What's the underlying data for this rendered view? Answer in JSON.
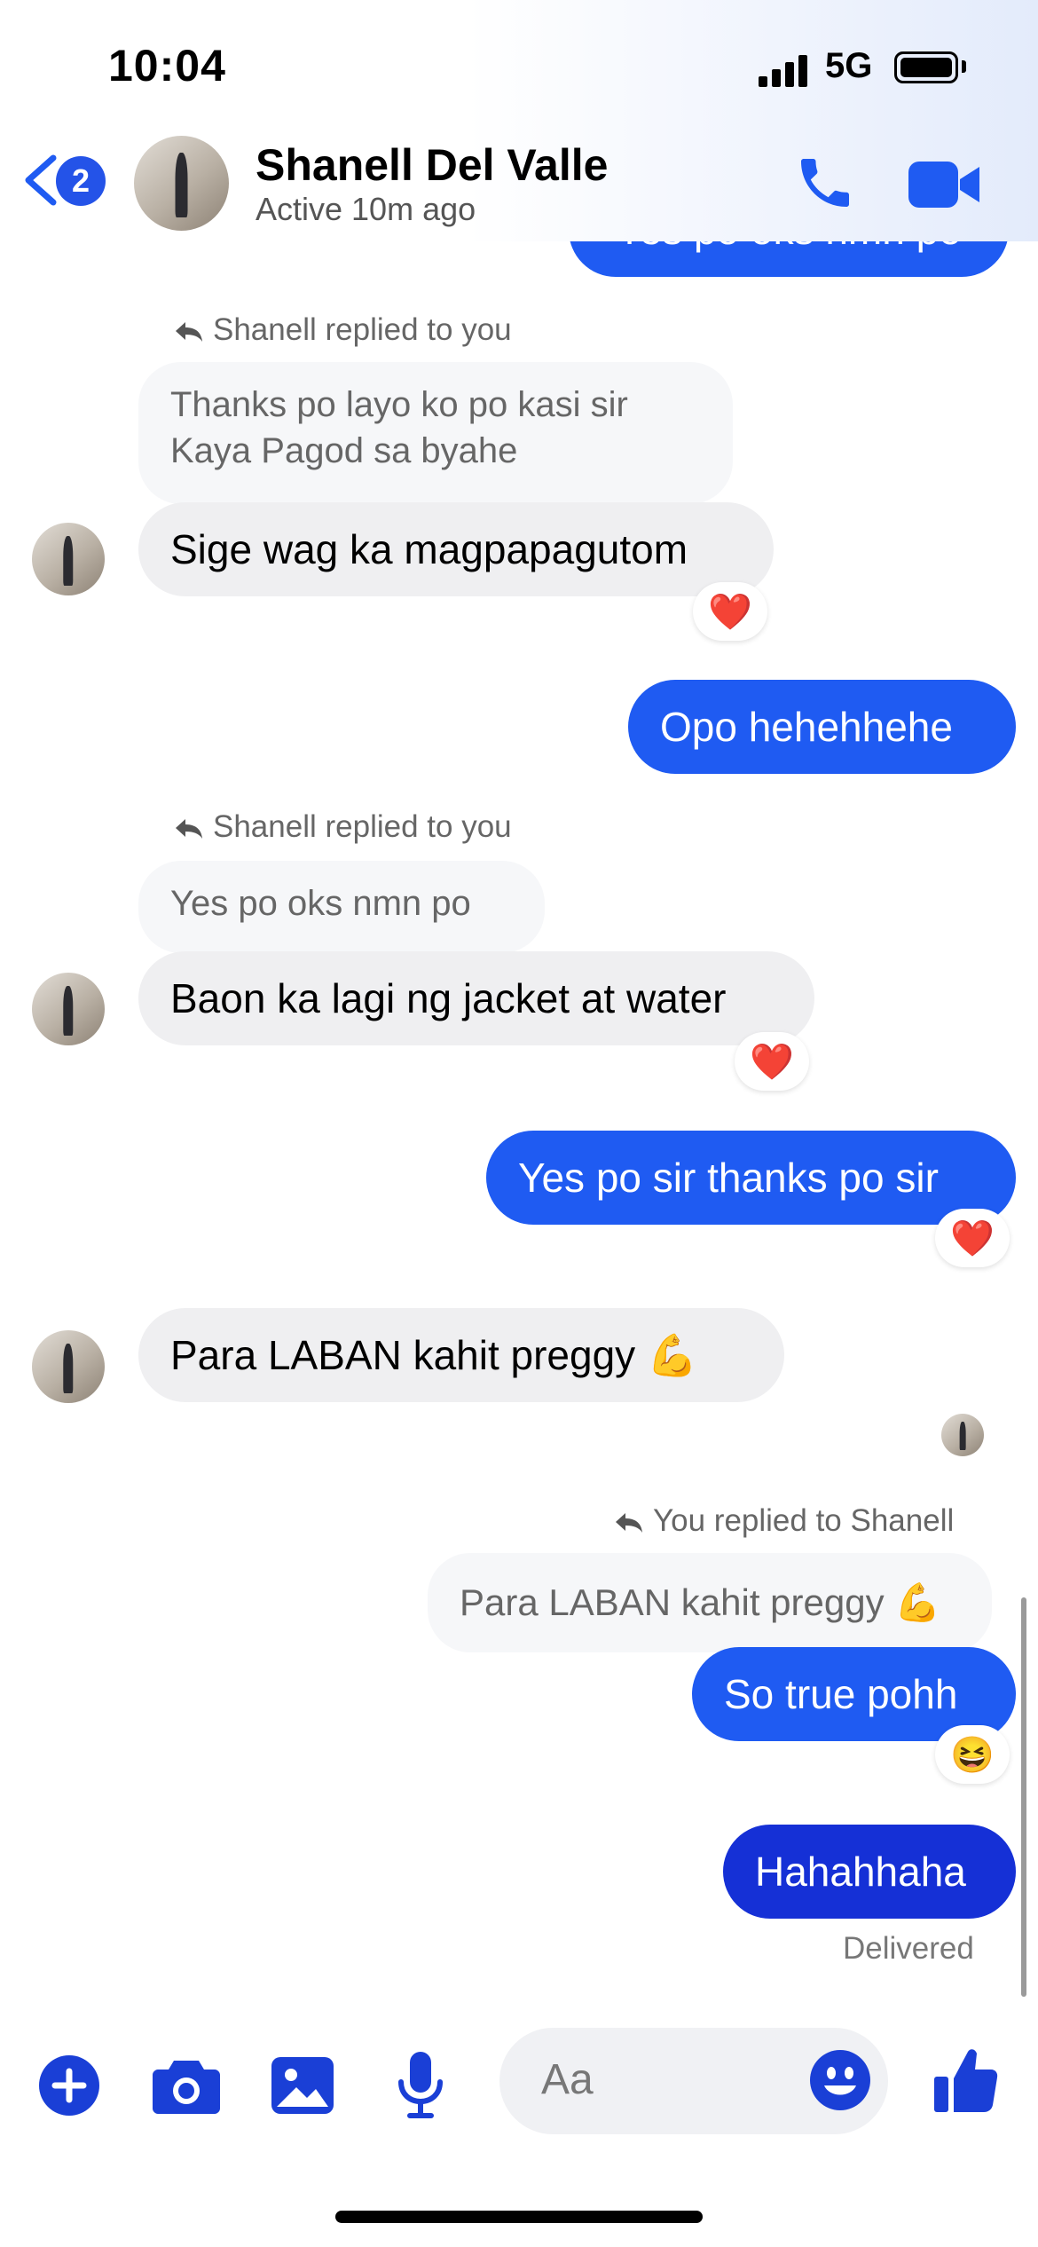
{
  "status_bar": {
    "time": "10:04",
    "network": "5G"
  },
  "header": {
    "badge_count": "2",
    "contact_name": "Shanell Del Valle",
    "contact_status": "Active 10m ago",
    "icons": [
      "back-chevron-icon",
      "phone-icon",
      "video-camera-icon"
    ]
  },
  "messages": {
    "partial_top": "Yes po oks nmn po",
    "reply1_label": "Shanell replied to you",
    "reply1_quote_line1": "Thanks po layo ko po kasi sir",
    "reply1_quote_line2": "Kaya Pagod sa byahe",
    "msg1": "Sige wag ka magpapagutom",
    "msg1_reaction": "❤️",
    "msg2": "Opo hehehhehe",
    "reply2_label": "Shanell replied to you",
    "reply2_quote": "Yes po oks nmn po",
    "msg3": "Baon ka lagi ng jacket at water",
    "msg3_reaction": "❤️",
    "msg4": "Yes po sir thanks po sir",
    "msg4_reaction": "❤️",
    "msg5": "Para LABAN kahit preggy 💪",
    "reply3_label": "You replied to Shanell",
    "reply3_quote": "Para LABAN kahit preggy 💪",
    "msg6": "So true pohh",
    "msg6_reaction": "😆",
    "msg7": "Hahahhaha",
    "delivered": "Delivered"
  },
  "composer": {
    "placeholder": "Aa",
    "icons": [
      "plus-icon",
      "camera-icon",
      "gallery-icon",
      "microphone-icon",
      "emoji-icon",
      "thumbs-up-icon"
    ]
  },
  "colors": {
    "accent": "#1f5bf2",
    "accent_dark": "#1530d6",
    "incoming_bubble": "#efeff1",
    "icon_blue": "#1a3fd6"
  }
}
